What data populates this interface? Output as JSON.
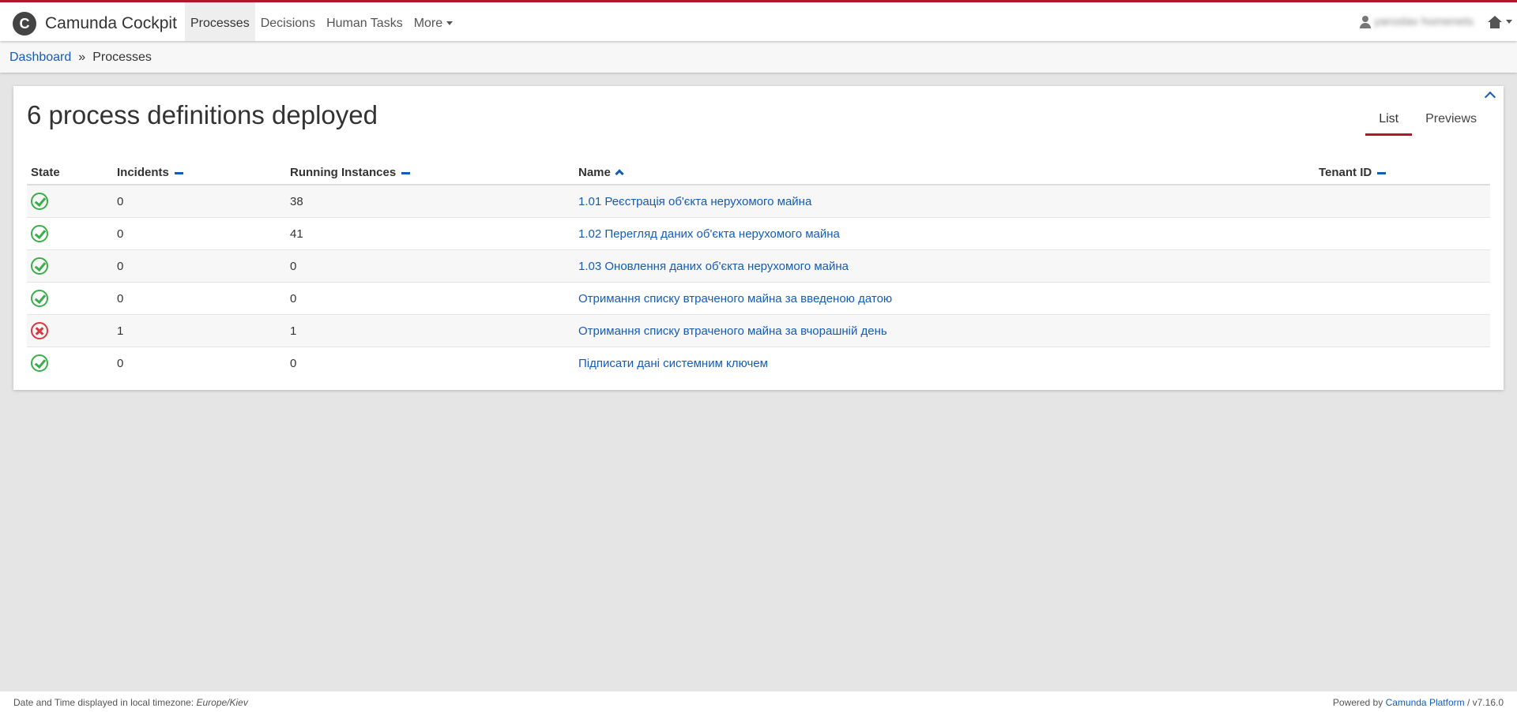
{
  "navbar": {
    "brand": "Camunda Cockpit",
    "logo_letter": "C",
    "items": [
      {
        "label": "Processes",
        "active": true
      },
      {
        "label": "Decisions"
      },
      {
        "label": "Human Tasks"
      },
      {
        "label": "More"
      }
    ],
    "user_name": "yaroslav homenets"
  },
  "breadcrumb": {
    "dashboard": "Dashboard",
    "separator": "»",
    "current": "Processes"
  },
  "panel": {
    "title": "6 process definitions deployed",
    "tabs": [
      {
        "label": "List",
        "active": true
      },
      {
        "label": "Previews"
      }
    ],
    "columns": {
      "state": "State",
      "incidents": "Incidents",
      "running": "Running Instances",
      "name": "Name",
      "tenant": "Tenant ID"
    },
    "rows": [
      {
        "state": "ok",
        "incidents": "0",
        "running": "38",
        "name": "1.01 Реєстрація об'єкта нерухомого майна",
        "tenant": ""
      },
      {
        "state": "ok",
        "incidents": "0",
        "running": "41",
        "name": "1.02 Перегляд даних об'єкта нерухомого майна",
        "tenant": ""
      },
      {
        "state": "ok",
        "incidents": "0",
        "running": "0",
        "name": "1.03 Оновлення даних об'єкта нерухомого майна",
        "tenant": ""
      },
      {
        "state": "ok",
        "incidents": "0",
        "running": "0",
        "name": "Отримання списку втраченого майна за введеною датою",
        "tenant": ""
      },
      {
        "state": "error",
        "incidents": "1",
        "running": "1",
        "name": "Отримання списку втраченого майна за вчорашній день",
        "tenant": ""
      },
      {
        "state": "ok",
        "incidents": "0",
        "running": "0",
        "name": "Підписати дані системним ключем",
        "tenant": ""
      }
    ]
  },
  "footer": {
    "timezone_prefix": "Date and Time displayed in local timezone:",
    "timezone": "Europe/Kiev",
    "powered_by": "Powered by",
    "platform": "Camunda Platform",
    "version": "/ v7.16.0"
  },
  "colors": {
    "accent_red": "#b5152b",
    "link_blue": "#155cb5",
    "ok_green": "#3bad4a",
    "error_red": "#d9363e"
  }
}
